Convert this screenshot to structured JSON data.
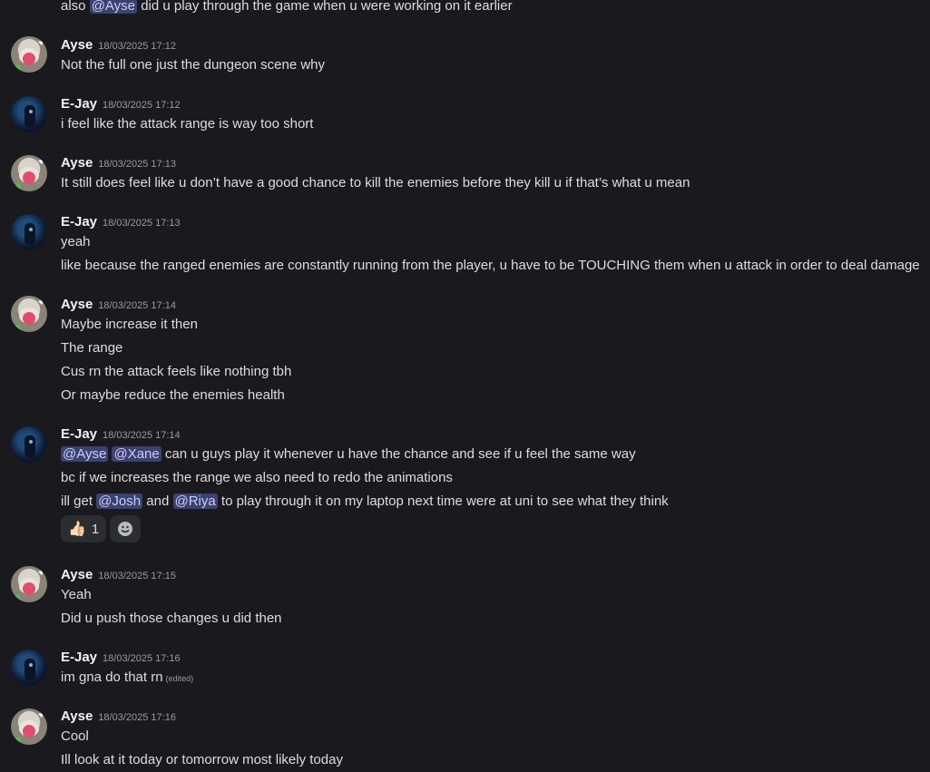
{
  "top_line": {
    "before": "also",
    "mention": "@Ayse",
    "after": "did u play through the game when u were working on it earlier"
  },
  "messages": [
    {
      "author": "Ayse",
      "timestamp": "18/03/2025 17:12",
      "lines": [
        "Not the full one just the dungeon scene why"
      ]
    },
    {
      "author": "E-Jay",
      "timestamp": "18/03/2025 17:12",
      "lines": [
        "i feel like the attack range is way too short"
      ]
    },
    {
      "author": "Ayse",
      "timestamp": "18/03/2025 17:13",
      "lines": [
        "It still does feel like u don’t have a good chance to kill the enemies before they kill u if that’s what u mean"
      ]
    },
    {
      "author": "E-Jay",
      "timestamp": "18/03/2025 17:13",
      "lines": [
        "yeah",
        "like because the ranged enemies are constantly running from the player, u have to be TOUCHING them when u attack in order to deal damage"
      ]
    },
    {
      "author": "Ayse",
      "timestamp": "18/03/2025 17:14",
      "lines": [
        "Maybe increase it then",
        "The range",
        "Cus rn the attack feels like nothing tbh",
        "Or maybe reduce the enemies health"
      ]
    },
    {
      "author": "E-Jay",
      "timestamp": "18/03/2025 17:14",
      "line1": {
        "m1": "@Ayse",
        "m2": "@Xane",
        "text": "can u guys play it whenever u have the chance and see if u feel the same way"
      },
      "line2": "bc if we increases the range we also need to redo the animations",
      "line3": {
        "before": "ill get",
        "m1": "@Josh",
        "mid": "and",
        "m2": "@Riya",
        "after": " to play through it on my laptop next time were at uni to see what they think"
      },
      "reactions": [
        {
          "emoji": "👍🏻",
          "count": "1"
        }
      ]
    },
    {
      "author": "Ayse",
      "timestamp": "18/03/2025 17:15",
      "lines": [
        "Yeah",
        "Did u push those changes u did then"
      ]
    },
    {
      "author": "E-Jay",
      "timestamp": "18/03/2025 17:16",
      "lines": [
        "im gna do that rn"
      ],
      "edited": "(edited)"
    },
    {
      "author": "Ayse",
      "timestamp": "18/03/2025 17:16",
      "lines": [
        "Cool",
        "Ill look at it today or tomorrow most likely today"
      ]
    }
  ],
  "colors": {
    "background": "#1a1a1e",
    "text": "#dbdee1",
    "mention_bg": "#3c4270",
    "timestamp": "#949ba4"
  }
}
